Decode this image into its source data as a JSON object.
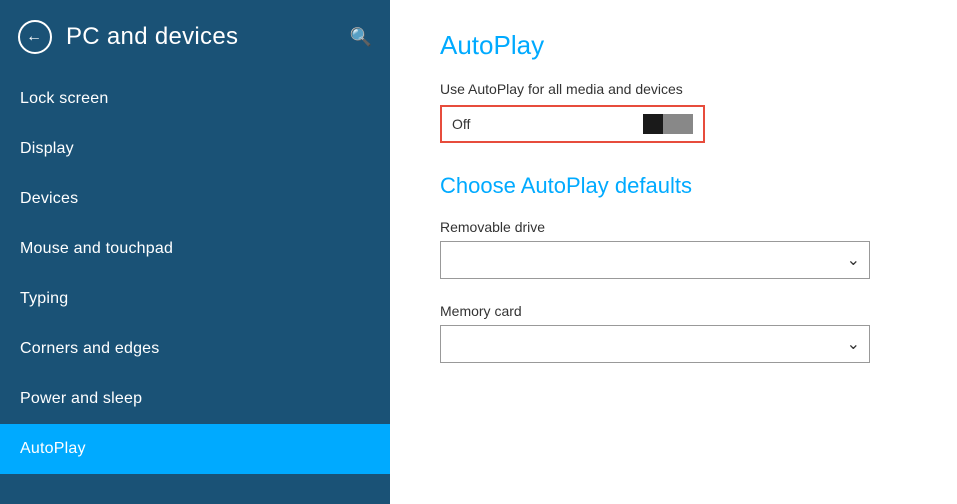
{
  "sidebar": {
    "title": "PC and devices",
    "back_label": "←",
    "search_icon": "🔍",
    "nav_items": [
      {
        "id": "lock-screen",
        "label": "Lock screen",
        "active": false
      },
      {
        "id": "display",
        "label": "Display",
        "active": false
      },
      {
        "id": "devices",
        "label": "Devices",
        "active": false
      },
      {
        "id": "mouse-touchpad",
        "label": "Mouse and touchpad",
        "active": false
      },
      {
        "id": "typing",
        "label": "Typing",
        "active": false
      },
      {
        "id": "corners-edges",
        "label": "Corners and edges",
        "active": false
      },
      {
        "id": "power-sleep",
        "label": "Power and sleep",
        "active": false
      },
      {
        "id": "autoplay",
        "label": "AutoPlay",
        "active": true
      }
    ]
  },
  "main": {
    "autoplay_title": "AutoPlay",
    "toggle_label": "Use AutoPlay for all media and devices",
    "toggle_state": "Off",
    "choose_title": "Choose AutoPlay defaults",
    "removable_drive_label": "Removable drive",
    "removable_drive_placeholder": "",
    "memory_card_label": "Memory card",
    "memory_card_placeholder": ""
  },
  "colors": {
    "sidebar_bg": "#1a5276",
    "active_item": "#00aaff",
    "accent": "#00aaff",
    "toggle_border": "#e74c3c"
  }
}
